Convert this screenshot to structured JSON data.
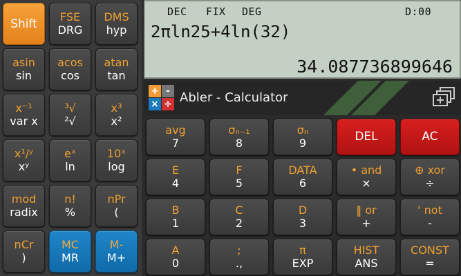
{
  "display": {
    "status": {
      "angle_mode": "DEC",
      "format": "FIX",
      "unit": "DEG",
      "memory": "D:00"
    },
    "expression": "2πln25+4ln(32)",
    "result": "34.087736899646"
  },
  "app": {
    "title": "Abler - Calculator"
  },
  "left_keys": [
    {
      "id": "shift",
      "sec": "",
      "pri": "Shift",
      "style": "orange"
    },
    {
      "id": "drg",
      "sec": "FSE",
      "pri": "DRG",
      "style": ""
    },
    {
      "id": "hyp",
      "sec": "DMS",
      "pri": "hyp",
      "style": ""
    },
    {
      "id": "sin",
      "sec": "asin",
      "pri": "sin",
      "style": ""
    },
    {
      "id": "cos",
      "sec": "acos",
      "pri": "cos",
      "style": ""
    },
    {
      "id": "tan",
      "sec": "atan",
      "pri": "tan",
      "style": ""
    },
    {
      "id": "varx",
      "sec": "x⁻¹",
      "pri": "var x",
      "style": ""
    },
    {
      "id": "sqrt",
      "sec": "³√",
      "pri": "²√",
      "style": ""
    },
    {
      "id": "square",
      "sec": "x³",
      "pri": "x²",
      "style": ""
    },
    {
      "id": "power",
      "sec": "x¹/ʸ",
      "pri": "xʸ",
      "style": ""
    },
    {
      "id": "ln",
      "sec": "eˣ",
      "pri": "ln",
      "style": ""
    },
    {
      "id": "log",
      "sec": "10ˣ",
      "pri": "log",
      "style": ""
    },
    {
      "id": "radix",
      "sec": "mod",
      "pri": "radix",
      "style": ""
    },
    {
      "id": "percent",
      "sec": "n!",
      "pri": "%",
      "style": ""
    },
    {
      "id": "open-paren",
      "sec": "nPr",
      "pri": "(",
      "style": ""
    },
    {
      "id": "close-paren",
      "sec": "nCr",
      "pri": ")",
      "style": ""
    },
    {
      "id": "mr",
      "sec": "MC",
      "pri": "MR",
      "style": "blue"
    },
    {
      "id": "mplus",
      "sec": "M-",
      "pri": "M+",
      "style": "blue"
    }
  ],
  "right_keys": [
    {
      "id": "7",
      "sec": "avg",
      "pri": "7",
      "style": ""
    },
    {
      "id": "8",
      "sec": "σₙ₋₁",
      "pri": "8",
      "style": ""
    },
    {
      "id": "9",
      "sec": "σₙ",
      "pri": "9",
      "style": ""
    },
    {
      "id": "del",
      "sec": "",
      "pri": "DEL",
      "style": "red"
    },
    {
      "id": "ac",
      "sec": "",
      "pri": "AC",
      "style": "red"
    },
    {
      "id": "4",
      "sec": "E",
      "pri": "4",
      "style": ""
    },
    {
      "id": "5",
      "sec": "F",
      "pri": "5",
      "style": ""
    },
    {
      "id": "6",
      "sec": "DATA",
      "pri": "6",
      "style": ""
    },
    {
      "id": "multiply",
      "sec": "• and",
      "pri": "×",
      "style": ""
    },
    {
      "id": "divide",
      "sec": "⊕ xor",
      "pri": "÷",
      "style": ""
    },
    {
      "id": "1",
      "sec": "B",
      "pri": "1",
      "style": ""
    },
    {
      "id": "2",
      "sec": "C",
      "pri": "2",
      "style": ""
    },
    {
      "id": "3",
      "sec": "D",
      "pri": "3",
      "style": ""
    },
    {
      "id": "plus",
      "sec": "‖ or",
      "pri": "+",
      "style": ""
    },
    {
      "id": "minus",
      "sec": "' not",
      "pri": "-",
      "style": ""
    },
    {
      "id": "0",
      "sec": "A",
      "pri": "0",
      "style": ""
    },
    {
      "id": "separator",
      "sec": ";",
      "pri": ".,",
      "style": ""
    },
    {
      "id": "exp",
      "sec": "π",
      "pri": "EXP",
      "style": ""
    },
    {
      "id": "ans",
      "sec": "HIST",
      "pri": "ANS",
      "style": ""
    },
    {
      "id": "equals",
      "sec": "CONST",
      "pri": "=",
      "style": ""
    }
  ],
  "colors": {
    "shift": "#f29a35",
    "memory": "#1a7cbf",
    "delete": "#c81a1a",
    "secondary_text": "#f0a030",
    "display_bg": "#c3d0c3"
  },
  "icons": {
    "logo": "calculator-logo-icon",
    "window": "multi-window-icon"
  }
}
